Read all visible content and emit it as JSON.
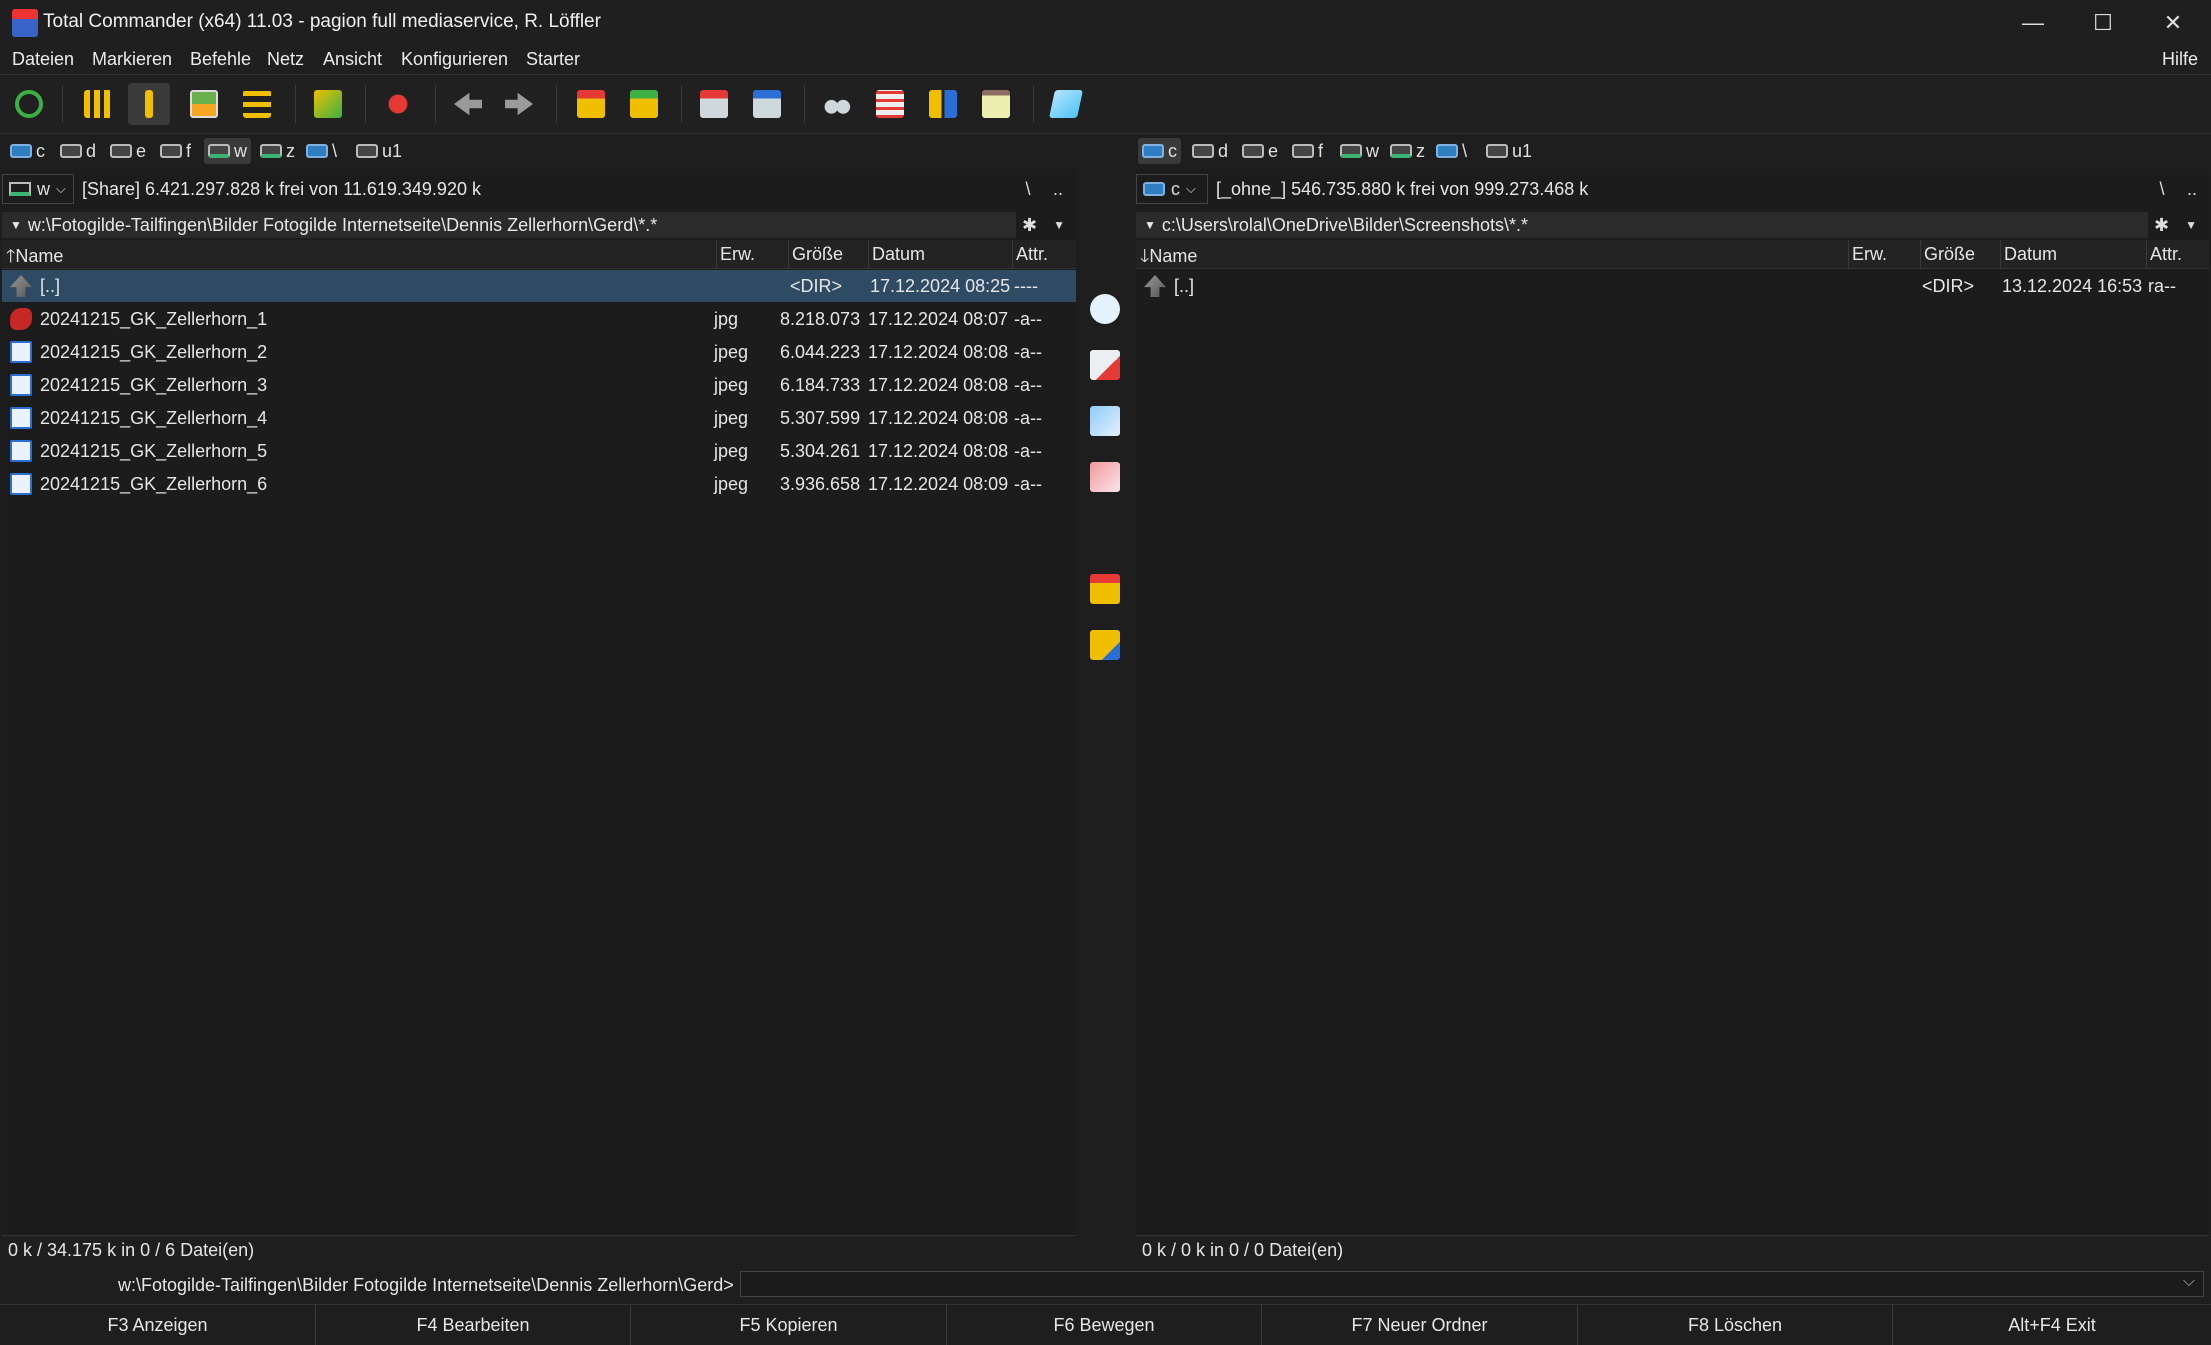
{
  "window": {
    "title": "Total Commander (x64) 11.03 - pagion full mediaservice, R. Löffler",
    "controls": [
      "—",
      "☐",
      "✕"
    ]
  },
  "menu": {
    "items": [
      "Dateien",
      "Markieren",
      "Befehle",
      "Netz",
      "Ansicht",
      "Konfigurieren",
      "Starter"
    ],
    "help": "Hilfe"
  },
  "toolbar": {
    "buttons": [
      "refresh-icon",
      "brief-view-icon",
      "detailed-view-icon",
      "thumbnail-view-icon",
      "tree-view-icon",
      "sync-dirs-icon",
      "invert-selection-icon",
      "back-icon",
      "forward-icon",
      "pack-icon",
      "unpack-icon",
      "ftp-connect-icon",
      "url-connect-icon",
      "search-icon",
      "rename-multi-icon",
      "compare-dirs-icon",
      "clipboard-icon",
      "notepad-icon"
    ]
  },
  "left_drives": [
    {
      "label": "c",
      "selected": false
    },
    {
      "label": "d",
      "selected": false
    },
    {
      "label": "e",
      "selected": false
    },
    {
      "label": "f",
      "selected": false
    },
    {
      "label": "w",
      "selected": true
    },
    {
      "label": "z",
      "selected": false
    },
    {
      "label": "\\",
      "selected": false
    },
    {
      "label": "u1",
      "selected": false
    }
  ],
  "right_drives": [
    {
      "label": "c",
      "selected": true
    },
    {
      "label": "d",
      "selected": false
    },
    {
      "label": "e",
      "selected": false
    },
    {
      "label": "f",
      "selected": false
    },
    {
      "label": "w",
      "selected": false
    },
    {
      "label": "z",
      "selected": false
    },
    {
      "label": "\\",
      "selected": false
    },
    {
      "label": "u1",
      "selected": false
    }
  ],
  "left_panel": {
    "drive": "w",
    "free_text": "[Share]  6.421.297.828 k frei von 11.619.349.920 k",
    "root": "\\",
    "up": "..",
    "path": "w:\\Fotogilde-Tailfingen\\Bilder Fotogilde Internetseite\\Dennis Zellerhorn\\Gerd\\*.*",
    "columns": {
      "name": "Name",
      "ext": "Erw.",
      "size": "Größe",
      "date": "Datum",
      "attr": "Attr."
    },
    "rows": [
      {
        "name": "[..]",
        "ext": "",
        "size": "<DIR>",
        "date": "17.12.2024 08:25",
        "attr": "----",
        "icon": "up",
        "selected": true
      },
      {
        "name": "20241215_GK_Zellerhorn_1",
        "ext": "jpg",
        "size": "8.218.073",
        "date": "17.12.2024 08:07",
        "attr": "-a--",
        "icon": "red",
        "selected": false
      },
      {
        "name": "20241215_GK_Zellerhorn_2",
        "ext": "jpeg",
        "size": "6.044.223",
        "date": "17.12.2024 08:08",
        "attr": "-a--",
        "icon": "img",
        "selected": false
      },
      {
        "name": "20241215_GK_Zellerhorn_3",
        "ext": "jpeg",
        "size": "6.184.733",
        "date": "17.12.2024 08:08",
        "attr": "-a--",
        "icon": "img",
        "selected": false
      },
      {
        "name": "20241215_GK_Zellerhorn_4",
        "ext": "jpeg",
        "size": "5.307.599",
        "date": "17.12.2024 08:08",
        "attr": "-a--",
        "icon": "img",
        "selected": false
      },
      {
        "name": "20241215_GK_Zellerhorn_5",
        "ext": "jpeg",
        "size": "5.304.261",
        "date": "17.12.2024 08:08",
        "attr": "-a--",
        "icon": "img",
        "selected": false
      },
      {
        "name": "20241215_GK_Zellerhorn_6",
        "ext": "jpeg",
        "size": "3.936.658",
        "date": "17.12.2024 08:09",
        "attr": "-a--",
        "icon": "img",
        "selected": false
      }
    ],
    "status": "0 k / 34.175 k in 0 / 6 Datei(en)"
  },
  "right_panel": {
    "drive": "c",
    "free_text": "[_ohne_]  546.735.880 k frei von 999.273.468 k",
    "root": "\\",
    "up": "..",
    "path": "c:\\Users\\rolal\\OneDrive\\Bilder\\Screenshots\\*.*",
    "columns": {
      "name": "Name",
      "ext": "Erw.",
      "size": "Größe",
      "date": "Datum",
      "attr": "Attr."
    },
    "rows": [
      {
        "name": "[..]",
        "ext": "",
        "size": "<DIR>",
        "date": "13.12.2024 16:53",
        "attr": "ra--",
        "icon": "up",
        "selected": false
      }
    ],
    "status": "0 k / 0 k in 0 / 0 Datei(en)"
  },
  "middle_bar": [
    "view-icon",
    "edit-icon",
    "copy-icon",
    "move-icon",
    "pack-icon",
    "new-folder-icon"
  ],
  "command_line": {
    "path": "w:\\Fotogilde-Tailfingen\\Bilder Fotogilde Internetseite\\Dennis Zellerhorn\\Gerd>",
    "value": ""
  },
  "function_keys": [
    "F3 Anzeigen",
    "F4 Bearbeiten",
    "F5 Kopieren",
    "F6 Bewegen",
    "F7 Neuer Ordner",
    "F8 Löschen",
    "Alt+F4 Exit"
  ]
}
